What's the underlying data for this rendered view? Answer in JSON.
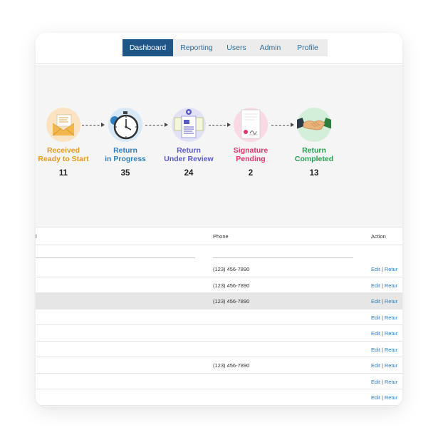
{
  "nav": {
    "items": [
      {
        "label": "Dashboard",
        "active": true
      },
      {
        "label": "Reporting"
      },
      {
        "label": "Users"
      },
      {
        "label": "Admin"
      },
      {
        "label": "Profile"
      }
    ]
  },
  "workflow": {
    "steps": [
      {
        "line1": "Received",
        "line2": "Ready to Start",
        "count": "11",
        "color": "#e59a22",
        "icon": "envelope-icon"
      },
      {
        "line1": "Return",
        "line2": "in Progress",
        "count": "35",
        "color": "#2c7fc0",
        "icon": "stopwatch-icon"
      },
      {
        "line1": "Return",
        "line2": "Under Review",
        "count": "24",
        "color": "#5b5bc7",
        "icon": "documents-review-icon"
      },
      {
        "line1": "Signature",
        "line2": "Pending",
        "count": "2",
        "color": "#e0336a",
        "icon": "signature-document-icon"
      },
      {
        "line1": "Return",
        "line2": "Completed",
        "count": "13",
        "color": "#27a050",
        "icon": "handshake-icon"
      }
    ]
  },
  "table": {
    "columns": {
      "partial": "l",
      "phone": "Phone",
      "action": "Action"
    },
    "action_edit": "Edit",
    "action_sep": "|",
    "action_return": "Retur",
    "rows": [
      {
        "phone": "(123) 456-7890"
      },
      {
        "phone": "(123) 456-7890"
      },
      {
        "phone": "(123) 456-7890"
      },
      {
        "phone": ""
      },
      {
        "phone": ""
      },
      {
        "phone": ""
      },
      {
        "phone": "(123) 456-7890"
      },
      {
        "phone": ""
      },
      {
        "phone": ""
      }
    ]
  }
}
